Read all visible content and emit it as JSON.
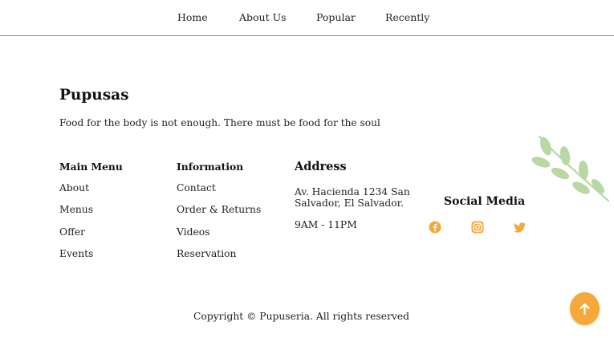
{
  "nav": {
    "items": [
      "Home",
      "About Us",
      "Popular",
      "Recently"
    ]
  },
  "brand": {
    "name": "Pupusas",
    "tagline": "Food for the body is not enough. There must be food for the soul"
  },
  "main_menu": {
    "title": "Main Menu",
    "links": [
      "About",
      "Menus",
      "Offer",
      "Events"
    ]
  },
  "information": {
    "title": "Information",
    "links": [
      "Contact",
      "Order & Returns",
      "Videos",
      "Reservation"
    ]
  },
  "address": {
    "title": "Address",
    "line1": "Av. Hacienda 1234 San",
    "line2": "Salvador, El Salvador.",
    "hours": "9AM - 11PM"
  },
  "social": {
    "title": "Social Media",
    "icons": [
      "facebook-icon",
      "instagram-icon",
      "twitter-icon"
    ],
    "accent_color": "#f6a93b"
  },
  "footer": {
    "copyright": "Copyright © Pupuseria. All rights reserved"
  },
  "colors": {
    "accent": "#f6a93b",
    "leaf": "#b9d8a3",
    "text": "#222222",
    "divider": "#8a8a8a"
  }
}
